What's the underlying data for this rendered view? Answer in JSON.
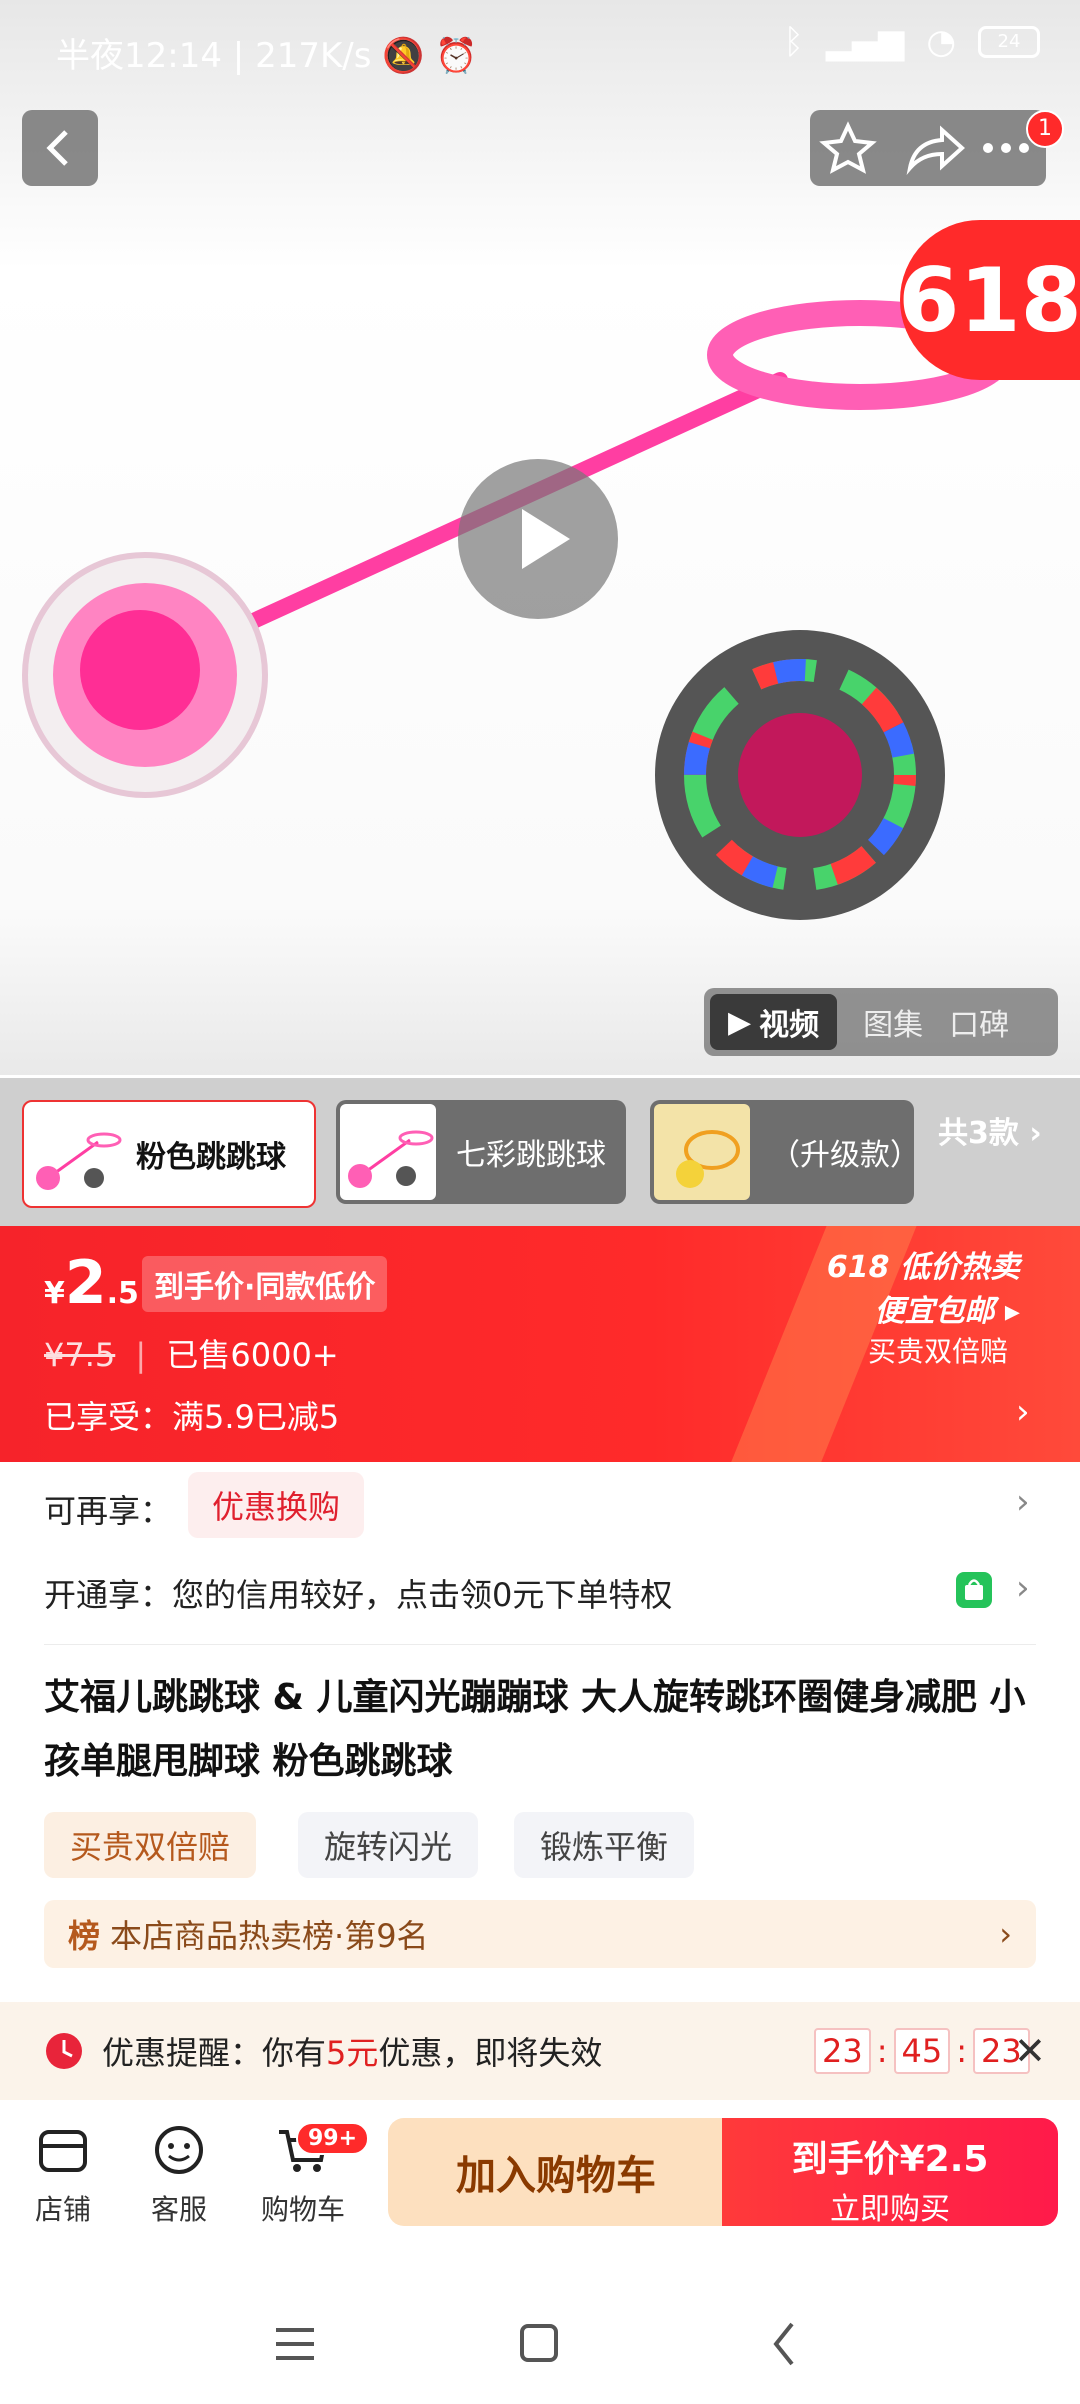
{
  "status_bar": {
    "time": "半夜12:14",
    "speed": "217K/s",
    "battery": "24"
  },
  "hero": {
    "badge": "618",
    "notif_count": "1",
    "media_tabs": {
      "video": "视频",
      "gallery": "图集",
      "reviews": "口碑"
    }
  },
  "variants": {
    "items": [
      {
        "label": "粉色跳跳球"
      },
      {
        "label": "七彩跳跳球"
      },
      {
        "label": "（升级款）"
      }
    ],
    "more": "共3款"
  },
  "price": {
    "currency": "¥",
    "integer": "2",
    "decimal": ".5",
    "tag": "到手价·同款低价",
    "original": "¥7.5",
    "sold": "已售6000+",
    "discount": "已享受：满5.9已减5",
    "promo_line1": "618 低价热卖",
    "promo_line2": "便宜包邮",
    "promo_line3": "买贵双倍赔"
  },
  "offers": {
    "row1_label": "可再享：",
    "row1_tag": "优惠换购",
    "row2_label": "开通享：",
    "row2_text": "您的信用较好，点击领0元下单特权"
  },
  "product": {
    "title": "艾福儿跳跳球 & 儿童闪光蹦蹦球 大人旋转跳环圈健身减肥 小孩单腿甩脚球 粉色跳跳球",
    "tags": [
      "买贵双倍赔",
      "旋转闪光",
      "锻炼平衡"
    ],
    "rank_icon": "榜",
    "rank_text": "本店商品热卖榜·第9名"
  },
  "reminder": {
    "prefix": "优惠提醒：你有",
    "amount": "5元",
    "suffix": "优惠，即将失效",
    "hh": "23",
    "mm": "45",
    "ss": "23"
  },
  "bottom_bar": {
    "shop": "店铺",
    "service": "客服",
    "cart": "购物车",
    "cart_badge": "99+",
    "add_to_cart": "加入购物车",
    "buy_line1_prefix": "到手价",
    "buy_line1_price": "¥2.5",
    "buy_line2": "立即购买"
  }
}
